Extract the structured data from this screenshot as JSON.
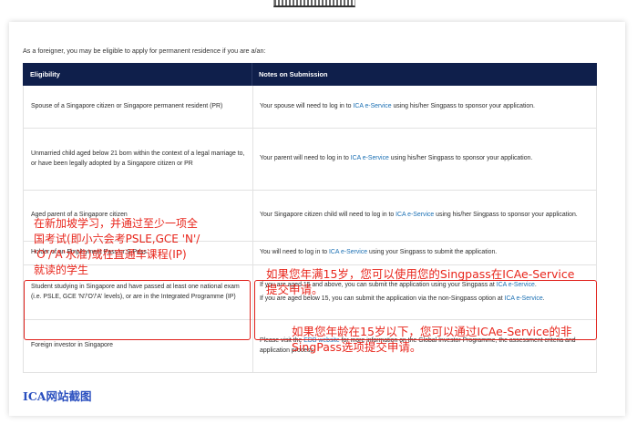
{
  "intro": "As a foreigner, you may be eligible to apply for permanent residence if you are a/an:",
  "table": {
    "headers": [
      "Eligibility",
      "Notes on Submission"
    ],
    "rows": [
      {
        "eligibility": "Spouse of a Singapore citizen or Singapore permanent resident (PR)",
        "note_pre": "Your spouse will need to log in to ",
        "note_link": "ICA e-Service",
        "note_post": " using his/her Singpass to sponsor your application."
      },
      {
        "eligibility": "Unmarried child aged below 21 born within the context of a legal marriage to, or have been legally adopted by a Singapore citizen or PR",
        "note_pre": "Your parent will need to log in to ",
        "note_link": "ICA e-Service",
        "note_post": " using his/her Singpass to sponsor your application."
      },
      {
        "eligibility": "Aged parent of a Singapore citizen",
        "note_pre": "Your Singapore citizen child will need to log in to ",
        "note_link": "ICA e-Service",
        "note_post": " using his/her Singpass to sponsor your application."
      },
      {
        "eligibility": "Holder of an Employment Pass or S Pass",
        "note_pre": "You will need to log in to ",
        "note_link": "ICA e-Service",
        "note_post": " using your Singpass to submit the application."
      },
      {
        "eligibility": "Student studying in Singapore and have passed at least one national exam (i.e. PSLE, GCE 'N'/'O'/'A' levels), or are in the Integrated Programme (IP)",
        "note1_pre": "If you are aged 15 and above, you can submit the application using your Singpass at ",
        "note1_link": "ICA e-Service",
        "note1_post": ".",
        "note2_pre": "If you are aged below 15, you can submit the application via the non-Singpass option at ",
        "note2_link": "ICA e-Service",
        "note2_post": "."
      },
      {
        "eligibility": "Foreign investor in Singapore",
        "note_pre": "Please visit the ",
        "note_link": "EDB website",
        "note_post": " for more information on the Global Investor Programme, the assessment criteria and application process."
      }
    ]
  },
  "annotations": {
    "student_cn": [
      "在新加坡学习，并通过至少一项全",
      "国考试(即小六会考PSLE,GCE 'N'/",
      "'O'/'A'水准)或在直通车课程(IP)",
      "就读的学生"
    ],
    "above15_cn": [
      "如果您年满15岁，您可以使用您的Singpass在ICAe-Service",
      "提交申请。"
    ],
    "below15_cn": [
      "如果您年龄在15岁以下，您可以通过ICAe-Service的非",
      "SingPass选项提交申请。"
    ]
  },
  "caption": "ICA网站截图",
  "colors": {
    "header_bg": "#0f1f4b",
    "link": "#1a6fb3",
    "annotation_red": "#e8261c",
    "caption_blue": "#2a4fbf"
  }
}
